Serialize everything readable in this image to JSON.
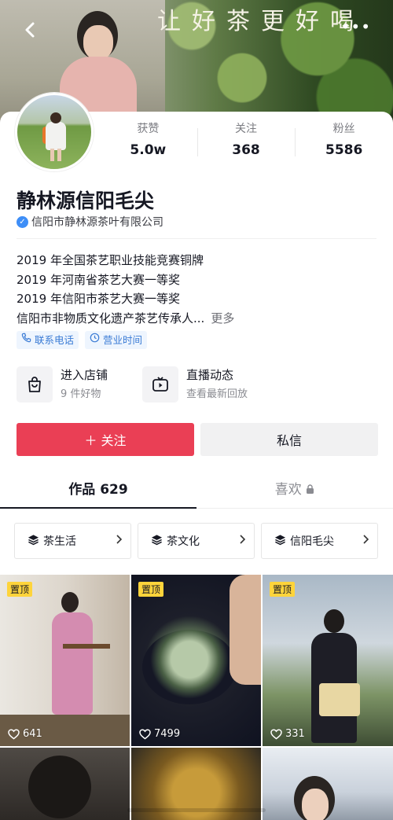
{
  "header": {
    "banner_text": "让好茶更好喝",
    "back_icon": "chevron-left-icon",
    "more_icon": "more-dots-icon"
  },
  "profile": {
    "name": "静林源信阳毛尖",
    "verified_org": "信阳市静林源茶叶有限公司",
    "stats": [
      {
        "label": "获赞",
        "value": "5.0w"
      },
      {
        "label": "关注",
        "value": "368"
      },
      {
        "label": "粉丝",
        "value": "5586"
      }
    ],
    "bio_lines": [
      "2019 年全国茶艺职业技能竞赛铜牌",
      "2019 年河南省茶艺大赛一等奖",
      "2019 年信阳市茶艺大赛一等奖",
      "信阳市非物质文化遗产茶艺传承人..."
    ],
    "bio_more": "更多",
    "tags": [
      {
        "label": "联系电话",
        "icon": "phone-icon"
      },
      {
        "label": "营业时间",
        "icon": "clock-icon"
      }
    ]
  },
  "entries": [
    {
      "title": "进入店铺",
      "subtitle": "9 件好物",
      "icon": "shopping-bag-icon"
    },
    {
      "title": "直播动态",
      "subtitle": "查看最新回放",
      "icon": "live-tv-icon"
    }
  ],
  "actions": {
    "follow_label": "＋ 关注",
    "message_label": "私信"
  },
  "tabs": [
    {
      "label": "作品 629",
      "active": true
    },
    {
      "label": "喜欢",
      "active": false,
      "icon": "lock-icon"
    }
  ],
  "collections": [
    {
      "label": "茶生活",
      "icon": "layers-icon"
    },
    {
      "label": "茶文化",
      "icon": "layers-icon"
    },
    {
      "label": "信阳毛尖",
      "icon": "layers-icon"
    }
  ],
  "videos": [
    {
      "pinned": "置顶",
      "likes": "641"
    },
    {
      "pinned": "置顶",
      "likes": "7499"
    },
    {
      "pinned": "置顶",
      "likes": "331"
    }
  ],
  "colors": {
    "accent": "#ea3f55",
    "tag_blue": "#3a7bd5",
    "pin_yellow": "#fed43b"
  }
}
